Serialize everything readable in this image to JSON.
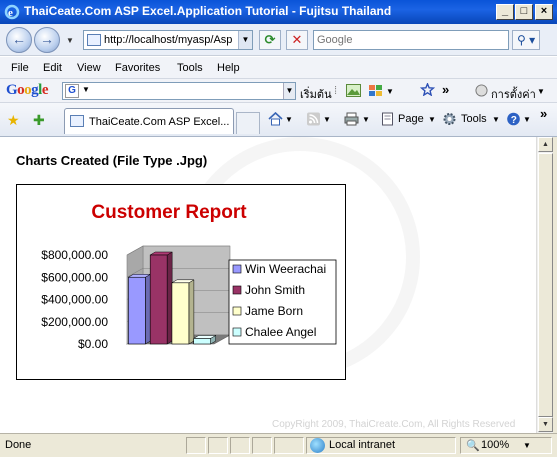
{
  "window": {
    "title": "ThaiCeate.Com ASP Excel.Application Tutorial - Fujitsu Thailand",
    "controls": {
      "minimize": "_",
      "maximize": "□",
      "close": "×"
    }
  },
  "addressbar": {
    "url": "http://localhost/myasp/Asp",
    "search_placeholder": "Google",
    "back_icon": "back-arrow-icon",
    "forward_icon": "forward-arrow-icon"
  },
  "menubar": {
    "items": [
      "File",
      "Edit",
      "View",
      "Favorites",
      "Tools",
      "Help"
    ]
  },
  "googlebar": {
    "logo": [
      "G",
      "o",
      "o",
      "g",
      "l",
      "e"
    ],
    "begin_label": "เริ่มต้น",
    "more": "»",
    "settings_label": "การตั้งค่า"
  },
  "tabbar": {
    "tab_label": "ThaiCeate.Com ASP Excel...",
    "more": "»",
    "page_label": "Page",
    "tools_label": "Tools"
  },
  "content": {
    "heading": "Charts Created (File Type .Jpg)",
    "copyright": "CopyRight 2009, ThaiCreate.Com, All Rights Reserved"
  },
  "chart_data": {
    "type": "bar",
    "title": "Customer Report",
    "categories": [
      "Win Weerachai",
      "John Smith",
      "Jame Born",
      "Chalee Angel"
    ],
    "values": [
      600000,
      800000,
      550000,
      50000
    ],
    "y_ticks": [
      "$0.00",
      "$200,000.00",
      "$400,000.00",
      "$600,000.00",
      "$800,000.00"
    ],
    "ylim": [
      0,
      800000
    ],
    "legend_position": "right",
    "colors": [
      "#9999ff",
      "#993366",
      "#ffffcc",
      "#ccffff"
    ],
    "title_color": "#cc0000",
    "style": "3d-column"
  },
  "statusbar": {
    "status": "Done",
    "zone": "Local intranet",
    "zoom": "100%"
  }
}
